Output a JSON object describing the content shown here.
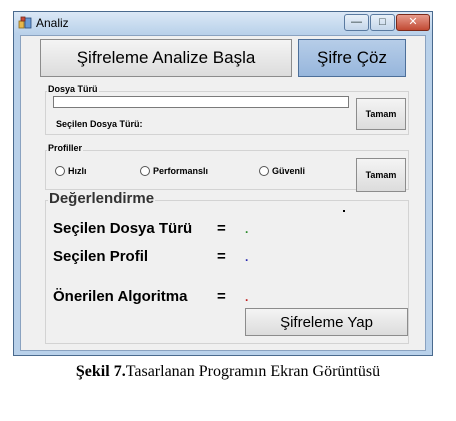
{
  "window": {
    "title": "Analiz",
    "controls": {
      "minimize": "—",
      "maximize": "□",
      "close": "✕"
    }
  },
  "toolbar": {
    "start_label": "Şifreleme Analize Başla",
    "decrypt_label": "Şifre Çöz"
  },
  "file_group": {
    "title": "Dosya Türü",
    "input_value": "",
    "selected_label": "Seçilen Dosya Türü:",
    "ok_label": "Tamam"
  },
  "profile_group": {
    "title": "Profiller",
    "options": [
      "Hızlı",
      "Performanslı",
      "Güvenli"
    ],
    "ok_label": "Tamam"
  },
  "evaluation": {
    "title": "Değerlendirme",
    "rows": [
      {
        "label": "Seçilen Dosya Türü",
        "equals": "=",
        "value": "."
      },
      {
        "label": "Seçilen Profil",
        "equals": "=",
        "value": "."
      },
      {
        "label": "Önerilen Algoritma",
        "equals": "=",
        "value": "."
      }
    ],
    "action_label": "Şifreleme Yap"
  },
  "caption": {
    "prefix": "Şekil 7.",
    "text": "Tasarlanan Programın Ekran Görüntüsü"
  },
  "colors": {
    "title_bar": "#b9d1ea",
    "highlight_button": "#a6c2e4",
    "value_green": "#2a8a2a",
    "value_blue": "#2a2ab0",
    "value_red": "#c02020"
  }
}
